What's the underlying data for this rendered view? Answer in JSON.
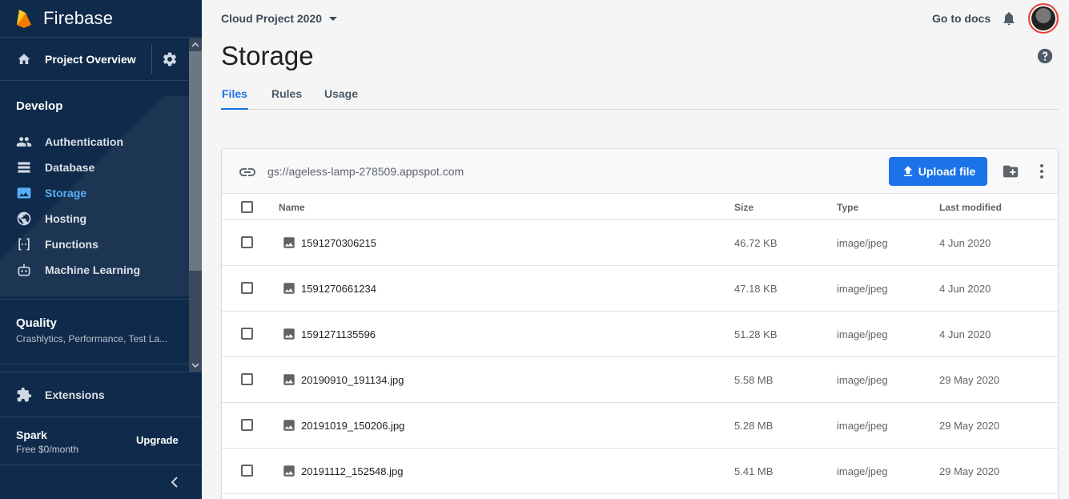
{
  "brand": {
    "name": "Firebase"
  },
  "sidebar": {
    "overview_label": "Project Overview",
    "develop_title": "Develop",
    "develop_items": [
      {
        "label": "Authentication",
        "icon": "people-icon"
      },
      {
        "label": "Database",
        "icon": "database-icon"
      },
      {
        "label": "Storage",
        "icon": "storage-icon",
        "active": true
      },
      {
        "label": "Hosting",
        "icon": "globe-icon"
      },
      {
        "label": "Functions",
        "icon": "functions-icon"
      },
      {
        "label": "Machine Learning",
        "icon": "robot-icon"
      }
    ],
    "quality_title": "Quality",
    "quality_subtitle": "Crashlytics, Performance, Test La...",
    "extensions_label": "Extensions",
    "plan_name": "Spark",
    "plan_price": "Free $0/month",
    "upgrade_label": "Upgrade"
  },
  "topbar": {
    "project_name": "Cloud Project 2020",
    "go_to_docs": "Go to docs"
  },
  "page": {
    "title": "Storage",
    "tabs": [
      {
        "label": "Files",
        "active": true
      },
      {
        "label": "Rules"
      },
      {
        "label": "Usage"
      }
    ]
  },
  "storage": {
    "bucket": "gs://ageless-lamp-278509.appspot.com",
    "upload_label": "Upload file",
    "columns": {
      "name": "Name",
      "size": "Size",
      "type": "Type",
      "modified": "Last modified"
    },
    "files": [
      {
        "name": "1591270306215",
        "size": "46.72 KB",
        "type": "image/jpeg",
        "modified": "4 Jun 2020"
      },
      {
        "name": "1591270661234",
        "size": "47.18 KB",
        "type": "image/jpeg",
        "modified": "4 Jun 2020"
      },
      {
        "name": "1591271135596",
        "size": "51.28 KB",
        "type": "image/jpeg",
        "modified": "4 Jun 2020"
      },
      {
        "name": "20190910_191134.jpg",
        "size": "5.58 MB",
        "type": "image/jpeg",
        "modified": "29 May 2020"
      },
      {
        "name": "20191019_150206.jpg",
        "size": "5.28 MB",
        "type": "image/jpeg",
        "modified": "29 May 2020"
      },
      {
        "name": "20191112_152548.jpg",
        "size": "5.41 MB",
        "type": "image/jpeg",
        "modified": "29 May 2020"
      }
    ]
  },
  "colors": {
    "sidebar_bg": "#0f2a4a",
    "accent": "#1a73e8",
    "active_nav": "#5ab0f7"
  }
}
